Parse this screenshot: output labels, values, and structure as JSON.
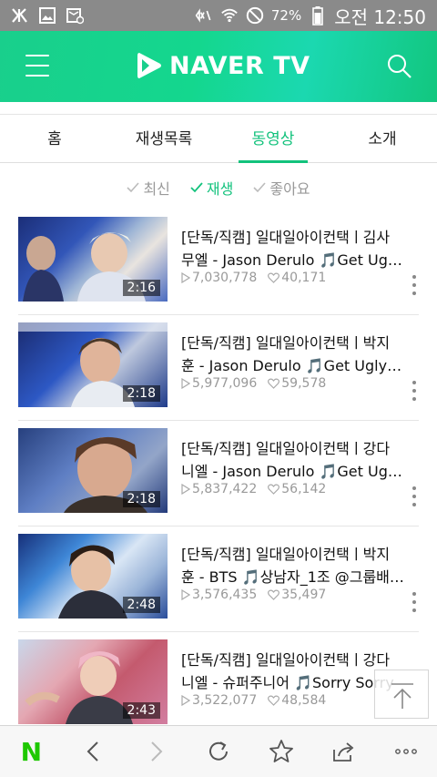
{
  "status_bar": {
    "battery": "72%",
    "time": "오전 12:50",
    "icons": [
      "signal-k-icon",
      "image-icon",
      "notification-icon",
      "mute-icon",
      "wifi-icon",
      "do-not-disturb-icon",
      "battery-icon"
    ]
  },
  "header": {
    "logo": "NAVER TV",
    "colors": {
      "accent": "#12c27c",
      "header_start": "#19cf8c",
      "header_end": "#1bd8b0"
    }
  },
  "tabs": [
    {
      "label": "홈"
    },
    {
      "label": "재생목록"
    },
    {
      "label": "동영상",
      "active": true
    },
    {
      "label": "소개"
    }
  ],
  "sort": [
    {
      "label": "최신"
    },
    {
      "label": "재생",
      "active": true
    },
    {
      "label": "좋아요"
    }
  ],
  "videos": [
    {
      "line1": "[단독/직캠] 일대일아이컨택ㅣ김사",
      "line2": "무엘 - Jason Derulo 🎵Get Ugly…",
      "duration": "2:16",
      "plays": "7,030,778",
      "likes": "40,171"
    },
    {
      "line1": "[단독/직캠] 일대일아이컨택ㅣ박지",
      "line2": "훈 - Jason Derulo 🎵Get Ugly @.",
      "duration": "2:18",
      "plays": "5,977,096",
      "likes": "59,578"
    },
    {
      "line1": "[단독/직캠] 일대일아이컨택ㅣ강다",
      "line2": "니엘 - Jason Derulo 🎵Get Ugly…",
      "duration": "2:18",
      "plays": "5,837,422",
      "likes": "56,142"
    },
    {
      "line1": "[단독/직캠] 일대일아이컨택ㅣ박지",
      "line2": "훈 - BTS 🎵상남자_1조 @그룹배…",
      "duration": "2:48",
      "plays": "3,576,435",
      "likes": "35,497"
    },
    {
      "line1": "[단독/직캠] 일대일아이컨택ㅣ강다",
      "line2": "니엘 - 슈퍼주니어 🎵Sorry Sorry",
      "duration": "2:43",
      "plays": "3,522,077",
      "likes": "48,584"
    }
  ],
  "bottom_bar": {
    "home": "N",
    "icons": [
      "naver-home-icon",
      "back-icon",
      "forward-icon",
      "refresh-icon",
      "bookmark-star-icon",
      "share-icon",
      "more-icon"
    ]
  }
}
